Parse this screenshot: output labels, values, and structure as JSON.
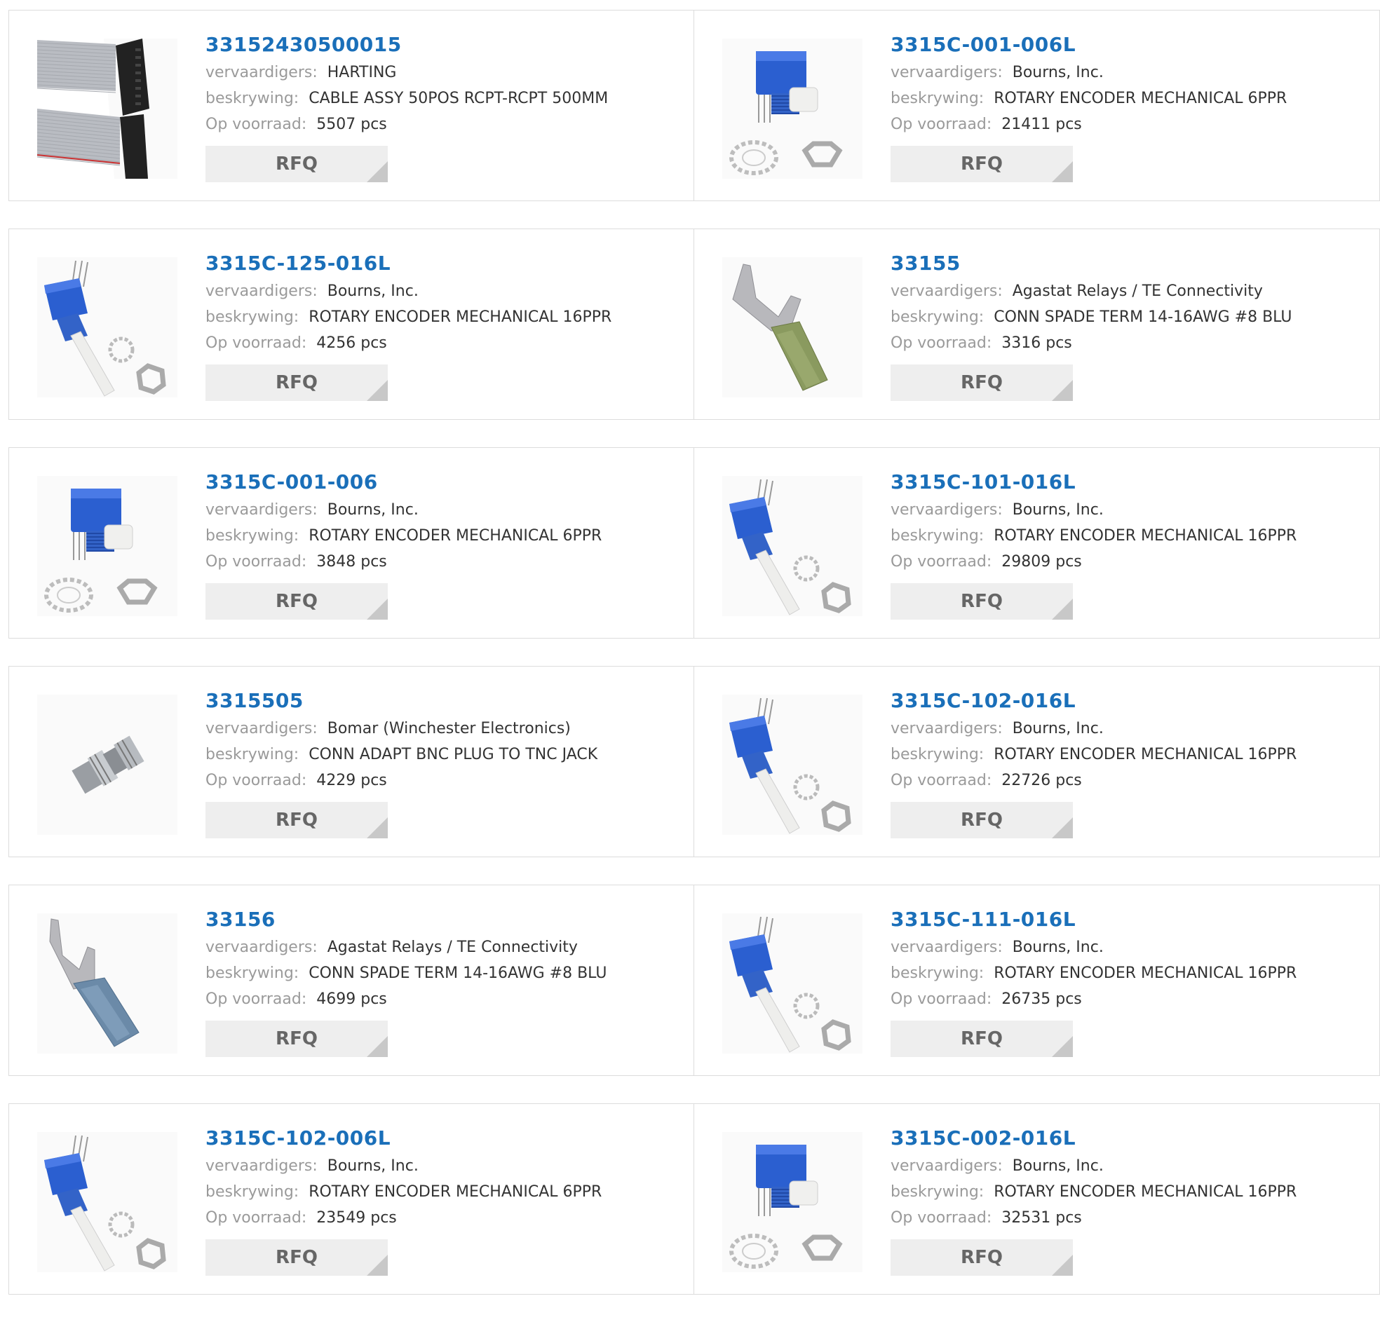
{
  "labels": {
    "manufacturer": "vervaardigers:",
    "description": "beskrywing:",
    "stock": "Op voorraad:",
    "rfq": "RFQ"
  },
  "products": [
    {
      "part": "33152430500015",
      "manufacturer": "HARTING",
      "description": "CABLE ASSY 50POS RCPT-RCPT 500MM",
      "stock": "5507 pcs",
      "image": "ribbon-cable"
    },
    {
      "part": "3315C-001-006L",
      "manufacturer": "Bourns, Inc.",
      "description": "ROTARY ENCODER MECHANICAL 6PPR",
      "stock": "21411 pcs",
      "image": "rotary-encoder-upright"
    },
    {
      "part": "3315C-125-016L",
      "manufacturer": "Bourns, Inc.",
      "description": "ROTARY ENCODER MECHANICAL 16PPR",
      "stock": "4256 pcs",
      "image": "rotary-encoder-angled"
    },
    {
      "part": "33155",
      "manufacturer": "Agastat Relays / TE Connectivity",
      "description": "CONN SPADE TERM 14-16AWG #8 BLU",
      "stock": "3316 pcs",
      "image": "spade-terminal-green"
    },
    {
      "part": "3315C-001-006",
      "manufacturer": "Bourns, Inc.",
      "description": "ROTARY ENCODER MECHANICAL 6PPR",
      "stock": "3848 pcs",
      "image": "rotary-encoder-upright"
    },
    {
      "part": "3315C-101-016L",
      "manufacturer": "Bourns, Inc.",
      "description": "ROTARY ENCODER MECHANICAL 16PPR",
      "stock": "29809 pcs",
      "image": "rotary-encoder-angled"
    },
    {
      "part": "3315505",
      "manufacturer": "Bomar (Winchester Electronics)",
      "description": "CONN ADAPT BNC PLUG TO TNC JACK",
      "stock": "4229 pcs",
      "image": "bnc-adapter"
    },
    {
      "part": "3315C-102-016L",
      "manufacturer": "Bourns, Inc.",
      "description": "ROTARY ENCODER MECHANICAL 16PPR",
      "stock": "22726 pcs",
      "image": "rotary-encoder-angled"
    },
    {
      "part": "33156",
      "manufacturer": "Agastat Relays / TE Connectivity",
      "description": "CONN SPADE TERM 14-16AWG #8 BLU",
      "stock": "4699 pcs",
      "image": "spade-terminal-blue"
    },
    {
      "part": "3315C-111-016L",
      "manufacturer": "Bourns, Inc.",
      "description": "ROTARY ENCODER MECHANICAL 16PPR",
      "stock": "26735 pcs",
      "image": "rotary-encoder-angled"
    },
    {
      "part": "3315C-102-006L",
      "manufacturer": "Bourns, Inc.",
      "description": "ROTARY ENCODER MECHANICAL 6PPR",
      "stock": "23549 pcs",
      "image": "rotary-encoder-angled"
    },
    {
      "part": "3315C-002-016L",
      "manufacturer": "Bourns, Inc.",
      "description": "ROTARY ENCODER MECHANICAL 16PPR",
      "stock": "32531 pcs",
      "image": "rotary-encoder-upright"
    }
  ],
  "colors": {
    "link": "#1a6fb9",
    "label": "#9a9a9a",
    "value": "#333333",
    "button_bg": "#eeeeee",
    "button_text": "#666666",
    "border": "#dcdcdc"
  }
}
